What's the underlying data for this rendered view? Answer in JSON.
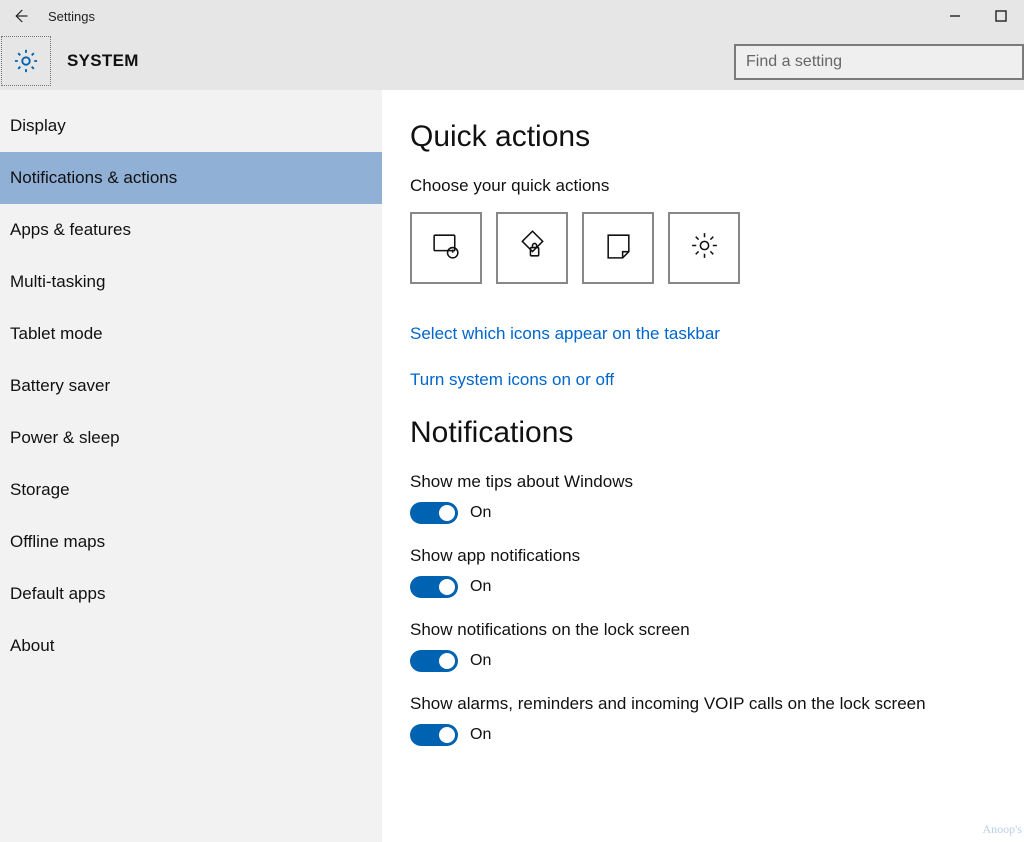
{
  "titlebar": {
    "title": "Settings"
  },
  "header": {
    "title": "SYSTEM",
    "search_placeholder": "Find a setting"
  },
  "sidebar": {
    "items": [
      {
        "label": "Display"
      },
      {
        "label": "Notifications & actions"
      },
      {
        "label": "Apps & features"
      },
      {
        "label": "Multi-tasking"
      },
      {
        "label": "Tablet mode"
      },
      {
        "label": "Battery saver"
      },
      {
        "label": "Power & sleep"
      },
      {
        "label": "Storage"
      },
      {
        "label": "Offline maps"
      },
      {
        "label": "Default apps"
      },
      {
        "label": "About"
      }
    ],
    "selected_index": 1
  },
  "content": {
    "quick_actions": {
      "heading": "Quick actions",
      "subtext": "Choose your quick actions",
      "tiles": [
        {
          "icon": "tablet-touch-icon"
        },
        {
          "icon": "rotation-lock-icon"
        },
        {
          "icon": "note-icon"
        },
        {
          "icon": "settings-gear-icon"
        }
      ],
      "link1": "Select which icons appear on the taskbar",
      "link2": "Turn system icons on or off"
    },
    "notifications": {
      "heading": "Notifications",
      "toggles": [
        {
          "label": "Show me tips about Windows",
          "state": "On"
        },
        {
          "label": "Show app notifications",
          "state": "On"
        },
        {
          "label": "Show notifications on the lock screen",
          "state": "On"
        },
        {
          "label": "Show alarms, reminders and incoming VOIP calls on the lock screen",
          "state": "On"
        }
      ]
    }
  },
  "watermark": "Anoop's"
}
